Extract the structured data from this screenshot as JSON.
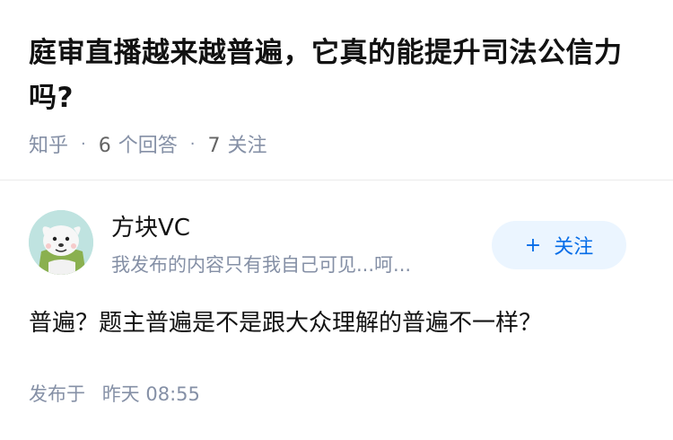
{
  "question": {
    "title": "庭审直播越来越普遍，它真的能提升司法公信力吗?",
    "source": "知乎",
    "answers_count": "6",
    "answers_label": "个回答",
    "followers_count": "7",
    "followers_label": "关注"
  },
  "author": {
    "name": "方块VC",
    "bio": "我发布的内容只有我自己可见...呵...",
    "follow_button": "关注",
    "follow_icon": "+",
    "avatar_icon": "cartoon-avatar-icon"
  },
  "answer": {
    "content": "普遍？题主普遍是不是跟大众理解的普遍不一样？",
    "time_label": "发布于",
    "time_day": "昨天",
    "time_clock": "08:55"
  },
  "colors": {
    "meta_gray": "#8590a6",
    "accent_blue": "#056de8",
    "button_bg": "#ebf5ff"
  }
}
